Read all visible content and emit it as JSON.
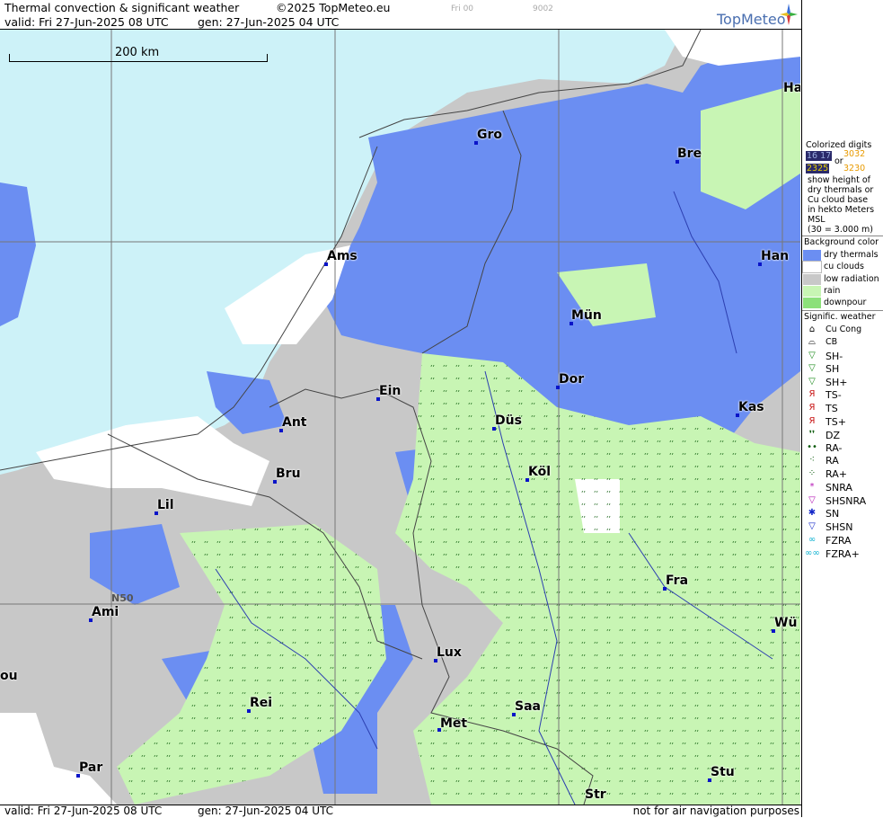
{
  "header": {
    "title": "Thermal convection & significant weather",
    "copyright": "©2025 TopMeteo.eu",
    "valid": "valid:  Fri  27-Jun-2025  08 UTC",
    "gen": "gen: 27-Jun-2025 04 UTC",
    "tiny_time": "Fri 00",
    "tiny_code": "9002",
    "brand": "TopMeteo"
  },
  "footer": {
    "valid": "valid:  Fri  27-Jun-2025  08 UTC",
    "gen": "gen: 27-Jun-2025 04 UTC",
    "disclaimer": "not for air navigation purposes"
  },
  "map": {
    "scale_label": "200 km",
    "lat_label": "N50",
    "cities": [
      {
        "name": "Gro"
      },
      {
        "name": "Bre"
      },
      {
        "name": "Ha"
      },
      {
        "name": "Ams"
      },
      {
        "name": "Han"
      },
      {
        "name": "Mün"
      },
      {
        "name": "Ein"
      },
      {
        "name": "Dor"
      },
      {
        "name": "Ant"
      },
      {
        "name": "Düs"
      },
      {
        "name": "Kas"
      },
      {
        "name": "Bru"
      },
      {
        "name": "Köl"
      },
      {
        "name": "Lil"
      },
      {
        "name": "Fra"
      },
      {
        "name": "Ami"
      },
      {
        "name": "Wü"
      },
      {
        "name": "Lux"
      },
      {
        "name": "ou"
      },
      {
        "name": "Rei"
      },
      {
        "name": "Saa"
      },
      {
        "name": "Met"
      },
      {
        "name": "Par"
      },
      {
        "name": "Stu"
      },
      {
        "name": "Str"
      }
    ],
    "colors": {
      "sea": "#cdf2f8",
      "dry_thermals": "#6b8ef2",
      "cu_clouds": "#ffffff",
      "low_radiation": "#c8c8c8",
      "rain": "#c8f5b4",
      "downpour": "#8ce07a"
    }
  },
  "legend": {
    "colorized_title": [
      "Colorized digits"
    ],
    "or": "or",
    "sample_a": "16 17",
    "sample_b": "3032",
    "sample_c": "2325",
    "sample_d": "3230",
    "desc": [
      "show height of",
      "dry thermals or",
      "Cu cloud base",
      "in hekto Meters",
      "MSL",
      "(30 = 3.000 m)"
    ],
    "bg_title": "Background color",
    "bg_items": [
      {
        "label": "dry thermals",
        "color": "#6b8ef2"
      },
      {
        "label": "cu clouds",
        "color": "#ffffff"
      },
      {
        "label": "low radiation",
        "color": "#c8c8c8"
      },
      {
        "label": "rain",
        "color": "#c8f5b4"
      },
      {
        "label": "downpour",
        "color": "#8ce07a"
      }
    ],
    "sig_title": "Signific. weather",
    "sig_items": [
      {
        "label": "Cu Cong",
        "icon": "cu-cong-icon",
        "glyph": "⌂",
        "color": "#000"
      },
      {
        "label": "CB",
        "icon": "cb-icon",
        "glyph": "⌓",
        "color": "#000"
      },
      {
        "label": "SH-",
        "icon": "shower-light-icon",
        "glyph": "▽",
        "color": "#1a8a1a"
      },
      {
        "label": "SH",
        "icon": "shower-icon",
        "glyph": "▽",
        "color": "#1a8a1a"
      },
      {
        "label": "SH+",
        "icon": "shower-heavy-icon",
        "glyph": "▽",
        "color": "#1a8a1a"
      },
      {
        "label": "TS-",
        "icon": "thunderstorm-light-icon",
        "glyph": "Я",
        "color": "#c81414"
      },
      {
        "label": "TS",
        "icon": "thunderstorm-icon",
        "glyph": "Я",
        "color": "#c81414"
      },
      {
        "label": "TS+",
        "icon": "thunderstorm-heavy-icon",
        "glyph": "Я",
        "color": "#c81414"
      },
      {
        "label": "DZ",
        "icon": "drizzle-icon",
        "glyph": "❜❜",
        "color": "#0a5a0a"
      },
      {
        "label": "RA-",
        "icon": "rain-light-icon",
        "glyph": "••",
        "color": "#0a5a0a"
      },
      {
        "label": "RA",
        "icon": "rain-icon",
        "glyph": "⁖",
        "color": "#0a5a0a"
      },
      {
        "label": "RA+",
        "icon": "rain-heavy-icon",
        "glyph": "⁘",
        "color": "#0a5a0a"
      },
      {
        "label": "SNRA",
        "icon": "snow-rain-icon",
        "glyph": "*",
        "color": "#b414b4"
      },
      {
        "label": "SHSNRA",
        "icon": "snow-rain-shower-icon",
        "glyph": "▽",
        "color": "#b414b4"
      },
      {
        "label": "SN",
        "icon": "snow-icon",
        "glyph": "✱",
        "color": "#1428c8"
      },
      {
        "label": "SHSN",
        "icon": "snow-shower-icon",
        "glyph": "▽",
        "color": "#1428c8"
      },
      {
        "label": "FZRA",
        "icon": "freezing-rain-icon",
        "glyph": "∞",
        "color": "#14b4d2"
      },
      {
        "label": "FZRA+",
        "icon": "freezing-rain-heavy-icon",
        "glyph": "∞∞",
        "color": "#14b4d2"
      }
    ]
  }
}
